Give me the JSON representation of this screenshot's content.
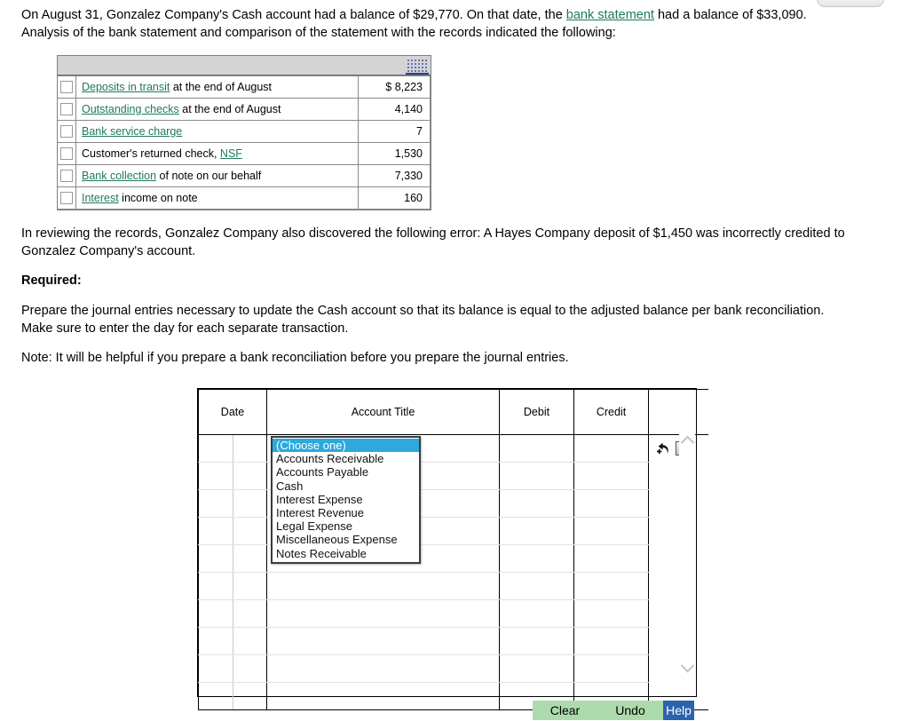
{
  "intro": {
    "part1": "On August 31, Gonzalez Company's Cash account had a balance of $29,770. On that date, the ",
    "link": "bank statement",
    "part2": " had a balance of $33,090. Analysis of the bank statement and comparison of the statement with the records indicated the following:"
  },
  "facts_table": {
    "rows": [
      {
        "label_link": "Deposits in transit",
        "label_rest": " at the end of August",
        "amount": "$ 8,223"
      },
      {
        "label_link": "Outstanding checks",
        "label_rest": " at the end of August",
        "amount": "4,140"
      },
      {
        "label_link": "Bank service charge",
        "label_rest": "",
        "amount": "7"
      },
      {
        "label_pre": "Customer's returned check, ",
        "label_link": "NSF",
        "label_rest": "",
        "amount": "1,530"
      },
      {
        "label_link": "Bank collection",
        "label_rest": " of note on our behalf",
        "amount": "7,330"
      },
      {
        "label_link": "Interest",
        "label_rest": " income on note",
        "amount": "160"
      }
    ]
  },
  "paragraphs": {
    "review": "In reviewing the records, Gonzalez Company also discovered the following error: A Hayes Company deposit of $1,450 was incorrectly credited to Gonzalez Company's account.",
    "required_heading": "Required:",
    "prepare": "Prepare the journal entries necessary to update the Cash account so that its balance is equal to the adjusted balance per bank reconciliation. Make sure to enter the day for each separate transaction.",
    "note": "Note: It will be helpful if you prepare a bank reconciliation before you prepare the journal entries."
  },
  "journal": {
    "headers": {
      "date": "Date",
      "account_title": "Account Title",
      "debit": "Debit",
      "credit": "Credit",
      "tools": ""
    },
    "row_count": 10,
    "row_tools": {
      "add_label": "",
      "delete_label": "×"
    },
    "dropdown": {
      "options": [
        "(Choose one)",
        "Accounts Receivable",
        "Accounts Payable",
        "Cash",
        "Interest Expense",
        "Interest Revenue",
        "Legal Expense",
        "Miscellaneous Expense",
        "Notes Receivable"
      ],
      "selected": "(Choose one)"
    }
  },
  "buttons": {
    "clear": "Clear",
    "undo": "Undo",
    "help": "Help"
  },
  "colors": {
    "link": "#1f7a5a",
    "dropdown_selected_bg": "#2ea8dd",
    "button_bg": "#addaad",
    "help_bg": "#2b63ad",
    "facts_header_bg": "#d4d4d4"
  }
}
